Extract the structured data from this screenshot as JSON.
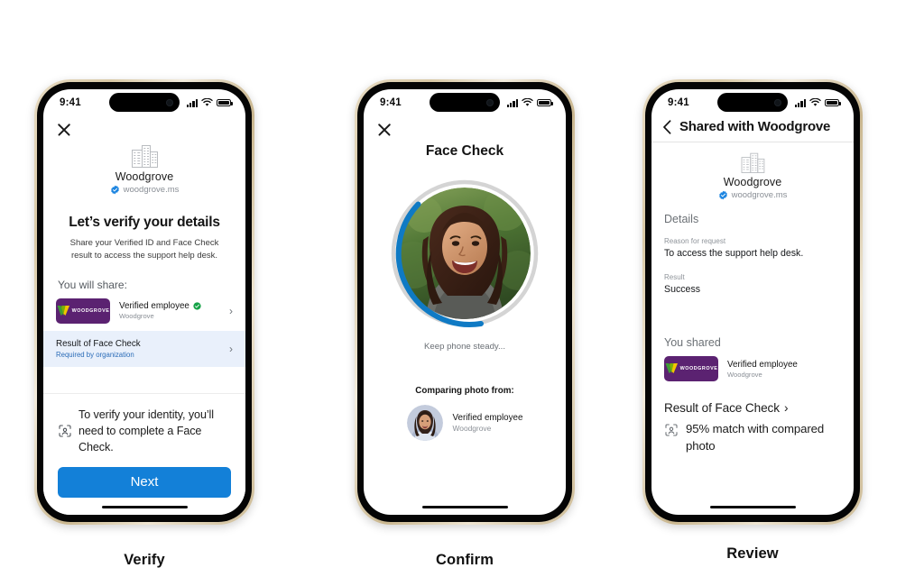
{
  "phones": [
    {
      "caption": "Verify",
      "status": {
        "time": "9:41",
        "signal_icon": "signal-bars-icon",
        "wifi_icon": "wifi-icon",
        "battery_icon": "battery-icon"
      },
      "close_icon": "close-icon",
      "org": {
        "icon": "building-icon",
        "name": "Woodgrove",
        "domain": "woodgrove.ms",
        "verified_icon": "verified-badge-icon"
      },
      "heading": "Let’s verify your details",
      "subheading": "Share your Verified ID and Face Check result to access the support help desk.",
      "share_label": "You will share:",
      "credentials": [
        {
          "logo_text": "WOODGROVE",
          "title": "Verified employee",
          "status_icon": "green-check-icon",
          "subtitle": "Woodgrove",
          "chevron": "›"
        }
      ],
      "facecheck_row": {
        "title": "Result of Face Check",
        "subtitle": "Required by organization",
        "chevron": "›"
      },
      "notice": {
        "icon": "face-scan-icon",
        "text": "To verify your identity, you’ll need to complete a Face Check."
      },
      "primary_button": "Next"
    },
    {
      "caption": "Confirm",
      "status": {
        "time": "9:41",
        "signal_icon": "signal-bars-icon",
        "wifi_icon": "wifi-icon",
        "battery_icon": "battery-icon"
      },
      "close_icon": "close-icon",
      "title": "Face Check",
      "scan": {
        "progress_percent": 45,
        "ring_color": "#0f7ac4",
        "track_color": "#d4d4d4",
        "status_text": "Keep phone steady..."
      },
      "compare_heading": "Comparing photo from:",
      "compare_item": {
        "avatar_icon": "employee-avatar",
        "title": "Verified employee",
        "subtitle": "Woodgrove"
      }
    },
    {
      "caption": "Review",
      "status": {
        "time": "9:41",
        "signal_icon": "signal-bars-icon",
        "wifi_icon": "wifi-icon",
        "battery_icon": "battery-icon"
      },
      "nav": {
        "back_icon": "back-chevron-icon",
        "title": "Shared with Woodgrove"
      },
      "org": {
        "icon": "building-icon",
        "name": "Woodgrove",
        "domain": "woodgrove.ms",
        "verified_icon": "verified-badge-icon"
      },
      "details_heading": "Details",
      "fields": [
        {
          "label": "Reason for request",
          "value": "To access the support help desk."
        },
        {
          "label": "Result",
          "value": "Success"
        }
      ],
      "shared_heading": "You shared",
      "credential": {
        "logo_text": "WOODGROVE",
        "title": "Verified employee",
        "subtitle": "Woodgrove"
      },
      "result": {
        "title": "Result of Face Check",
        "chevron": "›",
        "icon": "face-scan-icon",
        "text": "95% match with compared photo"
      }
    }
  ],
  "colors": {
    "accent_blue": "#1380d8",
    "ring_blue": "#0f7ac4",
    "brand_purple": "#5b2271",
    "highlight_row": "#e9f0fb",
    "link_blue": "#2b6cb8",
    "success_green": "#16a34a",
    "frame_gold": "#d9c9a6"
  }
}
